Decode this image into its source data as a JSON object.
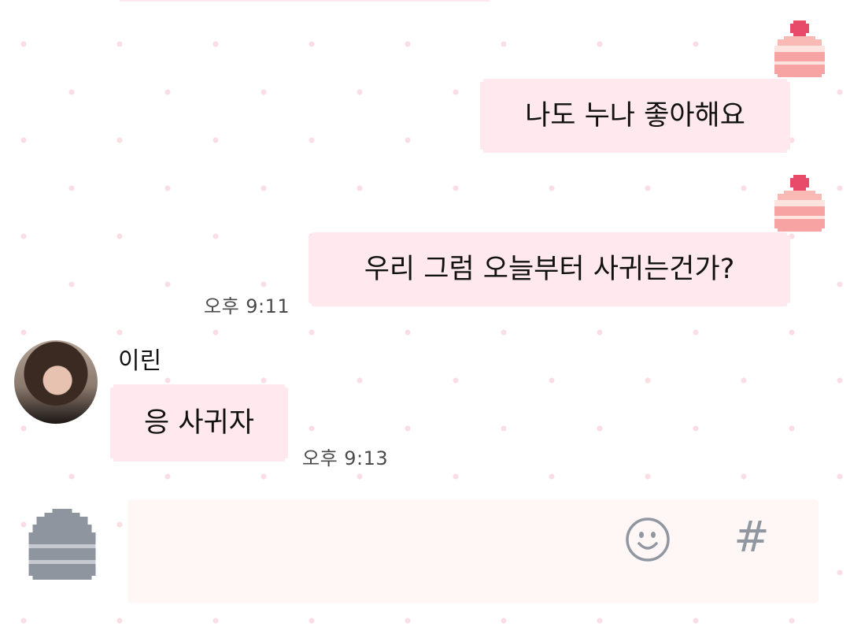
{
  "messages": [
    {
      "direction": "out",
      "text": "나도 누나 좋아해요"
    },
    {
      "direction": "out",
      "text": "우리 그럼 오늘부터 사귀는건가?",
      "time": "오후 9:11"
    },
    {
      "direction": "in",
      "sender": "이린",
      "text": "응 사귀자",
      "time": "오후 9:13"
    }
  ],
  "input": {
    "placeholder": "",
    "emoji_icon": "smiley-icon",
    "hashtag_label": "#"
  },
  "colors": {
    "bubble": "#ffe8ee",
    "input_bg": "#fff7f5",
    "dots": "#fbdde4",
    "icon_grey": "#9097a1",
    "cake_pink": "#f8a3a3"
  }
}
